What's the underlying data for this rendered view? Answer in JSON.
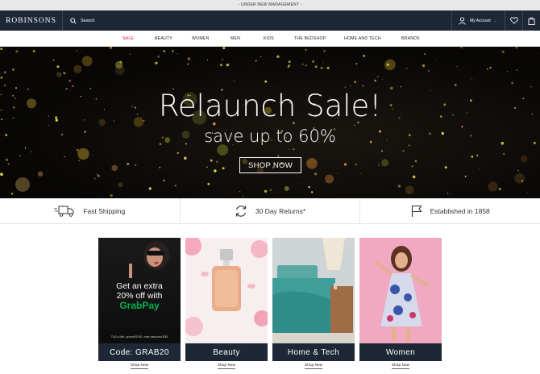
{
  "announcement": "- UNDER NEW MANAGEMENT -",
  "header": {
    "logo": "ROBINSONS",
    "search_label": "Search",
    "account_label": "My Account",
    "icons": [
      "search-icon",
      "user-icon",
      "heart-icon",
      "bag-icon"
    ]
  },
  "nav": {
    "items": [
      "SALE",
      "BEAUTY",
      "WOMEN",
      "MEN",
      "KIDS",
      "THE BEDSHOP",
      "HOME AND TECH",
      "BRANDS"
    ],
    "active": "SALE",
    "active_color": "#c8102e"
  },
  "hero": {
    "title": "Relaunch Sale!",
    "subtitle": "save up to 60%",
    "cta": "SHOP NOW"
  },
  "usps": [
    {
      "icon": "truck-icon",
      "label": "Fast Shipping"
    },
    {
      "icon": "returns-icon",
      "label": "30 Day Returns*"
    },
    {
      "icon": "flag-icon",
      "label": "Established in 1858"
    }
  ],
  "tiles": [
    {
      "label": "Code: GRAB20",
      "link": "Shop Now",
      "promo_line1": "Get an extra",
      "promo_line2": "20% off with",
      "promo_brand": "GrabPay",
      "promo_terms": "T&Cs Min. spend $100, max discount $30"
    },
    {
      "label": "Beauty",
      "link": "Shop Now"
    },
    {
      "label": "Home & Tech",
      "link": "Shop Now"
    },
    {
      "label": "Women",
      "link": "Shop Now"
    }
  ],
  "colors": {
    "header_bg": "#1e2735",
    "tile_label_bg": "#1e2735",
    "grabpay_green": "#00b14f",
    "accent_red": "#c8102e"
  }
}
